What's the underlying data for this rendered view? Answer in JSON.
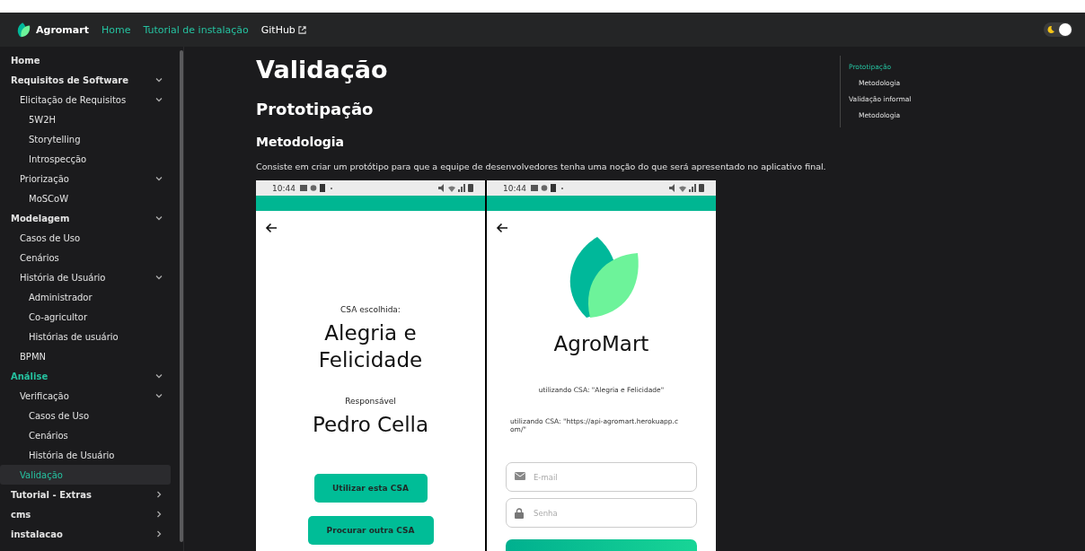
{
  "navbar": {
    "brand": "Agromart",
    "links": [
      {
        "label": "Home",
        "active": true,
        "external": false
      },
      {
        "label": "Tutorial de instalação",
        "active": true,
        "external": false
      },
      {
        "label": "GitHub",
        "active": false,
        "external": true
      }
    ],
    "dark_mode": true
  },
  "sidebar": {
    "items": [
      {
        "text": "Home",
        "selected": false
      },
      {
        "text": "Requisitos de Software",
        "selected": false,
        "expanded": true,
        "children": [
          {
            "text": "Elicitação de Requisitos",
            "selected": false,
            "expanded": true,
            "children": [
              {
                "text": "5W2H",
                "selected": false
              },
              {
                "text": "Storytelling",
                "selected": false
              },
              {
                "text": "Introspecção",
                "selected": false
              }
            ]
          },
          {
            "text": "Priorização",
            "selected": false,
            "expanded": true,
            "children": [
              {
                "text": "MoSCoW",
                "selected": false
              }
            ]
          }
        ]
      },
      {
        "text": "Modelagem",
        "selected": false,
        "expanded": true,
        "children": [
          {
            "text": "Casos de Uso",
            "selected": false
          },
          {
            "text": "Cenários",
            "selected": false
          },
          {
            "text": "História de Usuário",
            "selected": false,
            "expanded": true,
            "children": [
              {
                "text": "Administrador",
                "selected": false
              },
              {
                "text": "Co-agricultor",
                "selected": false
              },
              {
                "text": "Histórias de usuário",
                "selected": false
              }
            ]
          },
          {
            "text": "BPMN",
            "selected": false
          }
        ]
      },
      {
        "text": "Análise",
        "selected": false,
        "expanded": true,
        "children": [
          {
            "text": "Verificação",
            "selected": false,
            "expanded": true,
            "children": [
              {
                "text": "Casos de Uso",
                "selected": false
              },
              {
                "text": "Cenários",
                "selected": false
              },
              {
                "text": "História de Usuário",
                "selected": false
              }
            ]
          },
          {
            "text": "Validação",
            "selected": true
          }
        ]
      },
      {
        "text": "Tutorial - Extras",
        "selected": false,
        "expanded": false
      },
      {
        "text": "cms",
        "selected": false,
        "expanded": false
      },
      {
        "text": "instalacao",
        "selected": false,
        "expanded": false
      }
    ]
  },
  "content": {
    "title": "Validação",
    "heading": "Prototipação",
    "subheading": "Metodologia",
    "paragraph": "Consiste em criar um protótipo para que a equipe de desenvolvedores tenha uma noção do que será apresentado no aplicativo final.",
    "phones": [
      {
        "kind": "csa",
        "time": "10:44",
        "label_1": "CSA escolhida:",
        "name_1": "Alegria e Felicidade",
        "label_2": "Responsável",
        "name_2": "Pedro Cella",
        "buttons": [
          "Utilizar esta CSA",
          "Procurar outra CSA"
        ]
      },
      {
        "kind": "login",
        "time": "10:44",
        "app_name": "AgroMart",
        "note_1": "utilizando CSA: \"Alegria e Felicidade\"",
        "note_2": "utilizando CSA: \"https://api-agromart.herokuapp.com/\"",
        "fields": [
          {
            "kind": "email",
            "placeholder": "E-mail"
          },
          {
            "kind": "password",
            "placeholder": "Senha"
          }
        ]
      }
    ]
  },
  "toc": {
    "items": [
      {
        "text": "Prototipação",
        "selected": true,
        "children": [
          {
            "text": "Metodologia",
            "selected": false
          }
        ]
      },
      {
        "text": "Validação informal",
        "selected": false,
        "children": [
          {
            "text": "Metodologia",
            "selected": false
          }
        ]
      }
    ]
  }
}
